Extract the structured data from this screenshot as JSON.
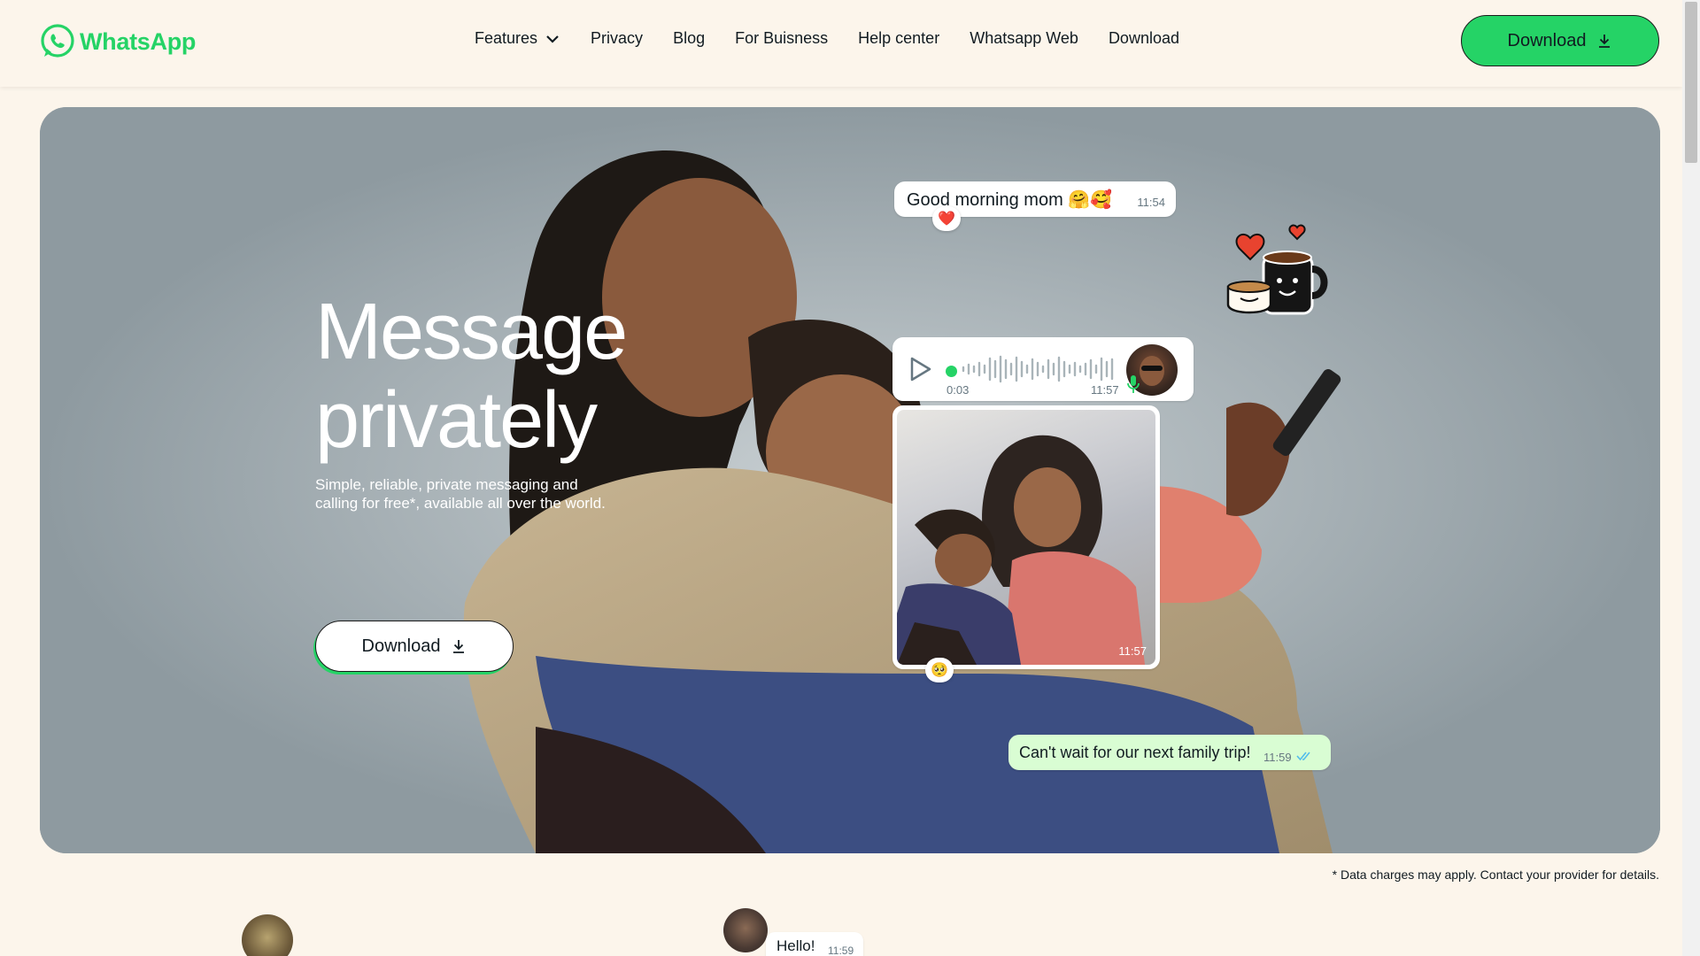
{
  "header": {
    "logo_text": "WhatsApp",
    "nav": [
      {
        "label": "Features"
      },
      {
        "label": "Privacy"
      },
      {
        "label": "Blog"
      },
      {
        "label": "For Buisness"
      },
      {
        "label": "Help center"
      },
      {
        "label": "Whatsapp Web"
      },
      {
        "label": "Download"
      }
    ],
    "download_label": "Download"
  },
  "hero": {
    "title_line1": "Message",
    "title_line2": "privately",
    "subtitle": "Simple, reliable, private messaging and calling for free*, available all over the world.",
    "download_label": "Download"
  },
  "chat": {
    "msg1_text": "Good morning mom 🤗🥰",
    "msg1_time": "11:54",
    "msg1_reaction": "❤️",
    "voice_duration": "0:03",
    "voice_time": "11:57",
    "photo_time": "11:57",
    "photo_reaction": "🥺",
    "msg2_text": "Can't wait for our next family trip!",
    "msg2_time": "11:59"
  },
  "footnote": "* Data charges may apply. Contact your provider for details.",
  "bottom": {
    "hello_text": "Hello!",
    "hello_time": "11:59"
  },
  "colors": {
    "brand_green": "#25d366",
    "page_bg": "#fcf5eb",
    "outgoing_bubble": "#d9fdd3"
  }
}
